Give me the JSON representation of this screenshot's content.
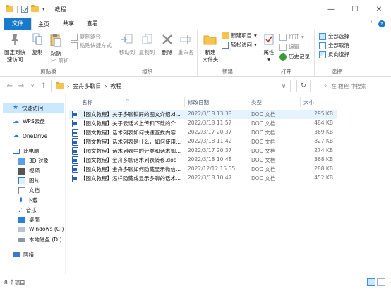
{
  "window": {
    "title": "教程",
    "minimize": "—",
    "maximize": "☐",
    "close": "✕"
  },
  "tabs": [
    {
      "label": "文件"
    },
    {
      "label": "主页"
    },
    {
      "label": "共享"
    },
    {
      "label": "查看"
    }
  ],
  "help": {
    "chevron": "˄",
    "q": "?"
  },
  "ribbon": {
    "clipboard": {
      "label": "剪贴板",
      "pin": "固定到快\n速访问",
      "copy": "复制",
      "paste": "粘贴",
      "copy_path": "复制路径",
      "paste_shortcut": "粘贴快捷方式",
      "cut": "剪切"
    },
    "organize": {
      "label": "组织",
      "move_to": "移动到",
      "copy_to": "复制到",
      "delete": "删除",
      "rename": "重命名"
    },
    "new": {
      "label": "新建",
      "new_folder": "新建\n文件夹",
      "new_item": "新建项目",
      "easy_access": "轻松访问"
    },
    "open": {
      "label": "打开",
      "properties": "属性",
      "open": "打开",
      "edit": "编辑",
      "history": "历史记录"
    },
    "select": {
      "label": "选择",
      "select_all": "全部选择",
      "select_none": "全部取消",
      "invert": "反向选择"
    }
  },
  "address": {
    "path": [
      "金舟多聊日",
      "教程"
    ],
    "search_placeholder": "在 教程 中搜索"
  },
  "nav": [
    {
      "label": "快速访问",
      "icon": "star-icon"
    },
    {
      "label": "WPS云盘",
      "icon": "cloud-icon"
    },
    {
      "label": "OneDrive",
      "icon": "cloud-icon"
    },
    {
      "label": "此电脑",
      "icon": "computer-icon"
    },
    {
      "label": "3D 对象",
      "icon": "cube-icon"
    },
    {
      "label": "视频",
      "icon": "video-icon"
    },
    {
      "label": "图片",
      "icon": "picture-icon"
    },
    {
      "label": "文档",
      "icon": "document-icon"
    },
    {
      "label": "下载",
      "icon": "download-icon"
    },
    {
      "label": "音乐",
      "icon": "music-icon"
    },
    {
      "label": "桌面",
      "icon": "desktop-icon"
    },
    {
      "label": "Windows (C:)",
      "icon": "drive-icon"
    },
    {
      "label": "本地磁盘 (D:)",
      "icon": "drive-icon"
    },
    {
      "label": "网络",
      "icon": "network-icon"
    }
  ],
  "columns": {
    "name": "名称",
    "date": "修改日期",
    "type": "类型",
    "size": "大小"
  },
  "files": [
    {
      "name": "【图文教程】关于多聊锁屏的图文介绍.d...",
      "date": "2022/3/18 13:38",
      "type": "DOC 文档",
      "size": "295 KB"
    },
    {
      "name": "【图文教程】关于云话术上传和下载的介...",
      "date": "2022/3/18 11:57",
      "type": "DOC 文档",
      "size": "484 KB"
    },
    {
      "name": "【图文教程】话术列表如何快速查找内容...",
      "date": "2022/3/17 20:37",
      "type": "DOC 文档",
      "size": "369 KB"
    },
    {
      "name": "【图文教程】话术列表是什么，如何使用...",
      "date": "2022/3/18 11:42",
      "type": "DOC 文档",
      "size": "827 KB"
    },
    {
      "name": "【图文教程】话术列表中的分类和话术如...",
      "date": "2022/3/17 20:37",
      "type": "DOC 文档",
      "size": "274 KB"
    },
    {
      "name": "【图文教程】金舟多聊话术列表转移.doc",
      "date": "2022/3/18 10:48",
      "type": "DOC 文档",
      "size": "368 KB"
    },
    {
      "name": "【图文教程】金舟多聊如何隐藏显示微信...",
      "date": "2022/12/12 15:55",
      "type": "DOC 文档",
      "size": "288 KB"
    },
    {
      "name": "【图文教程】怎样隐藏或显示多聊的话术...",
      "date": "2022/3/18 10:47",
      "type": "DOC 文档",
      "size": "452 KB"
    }
  ],
  "status": {
    "count": "8 个项目"
  },
  "colors": {
    "accent": "#1979ca",
    "selection": "#cce8ff",
    "folder": "#f4c44e"
  }
}
